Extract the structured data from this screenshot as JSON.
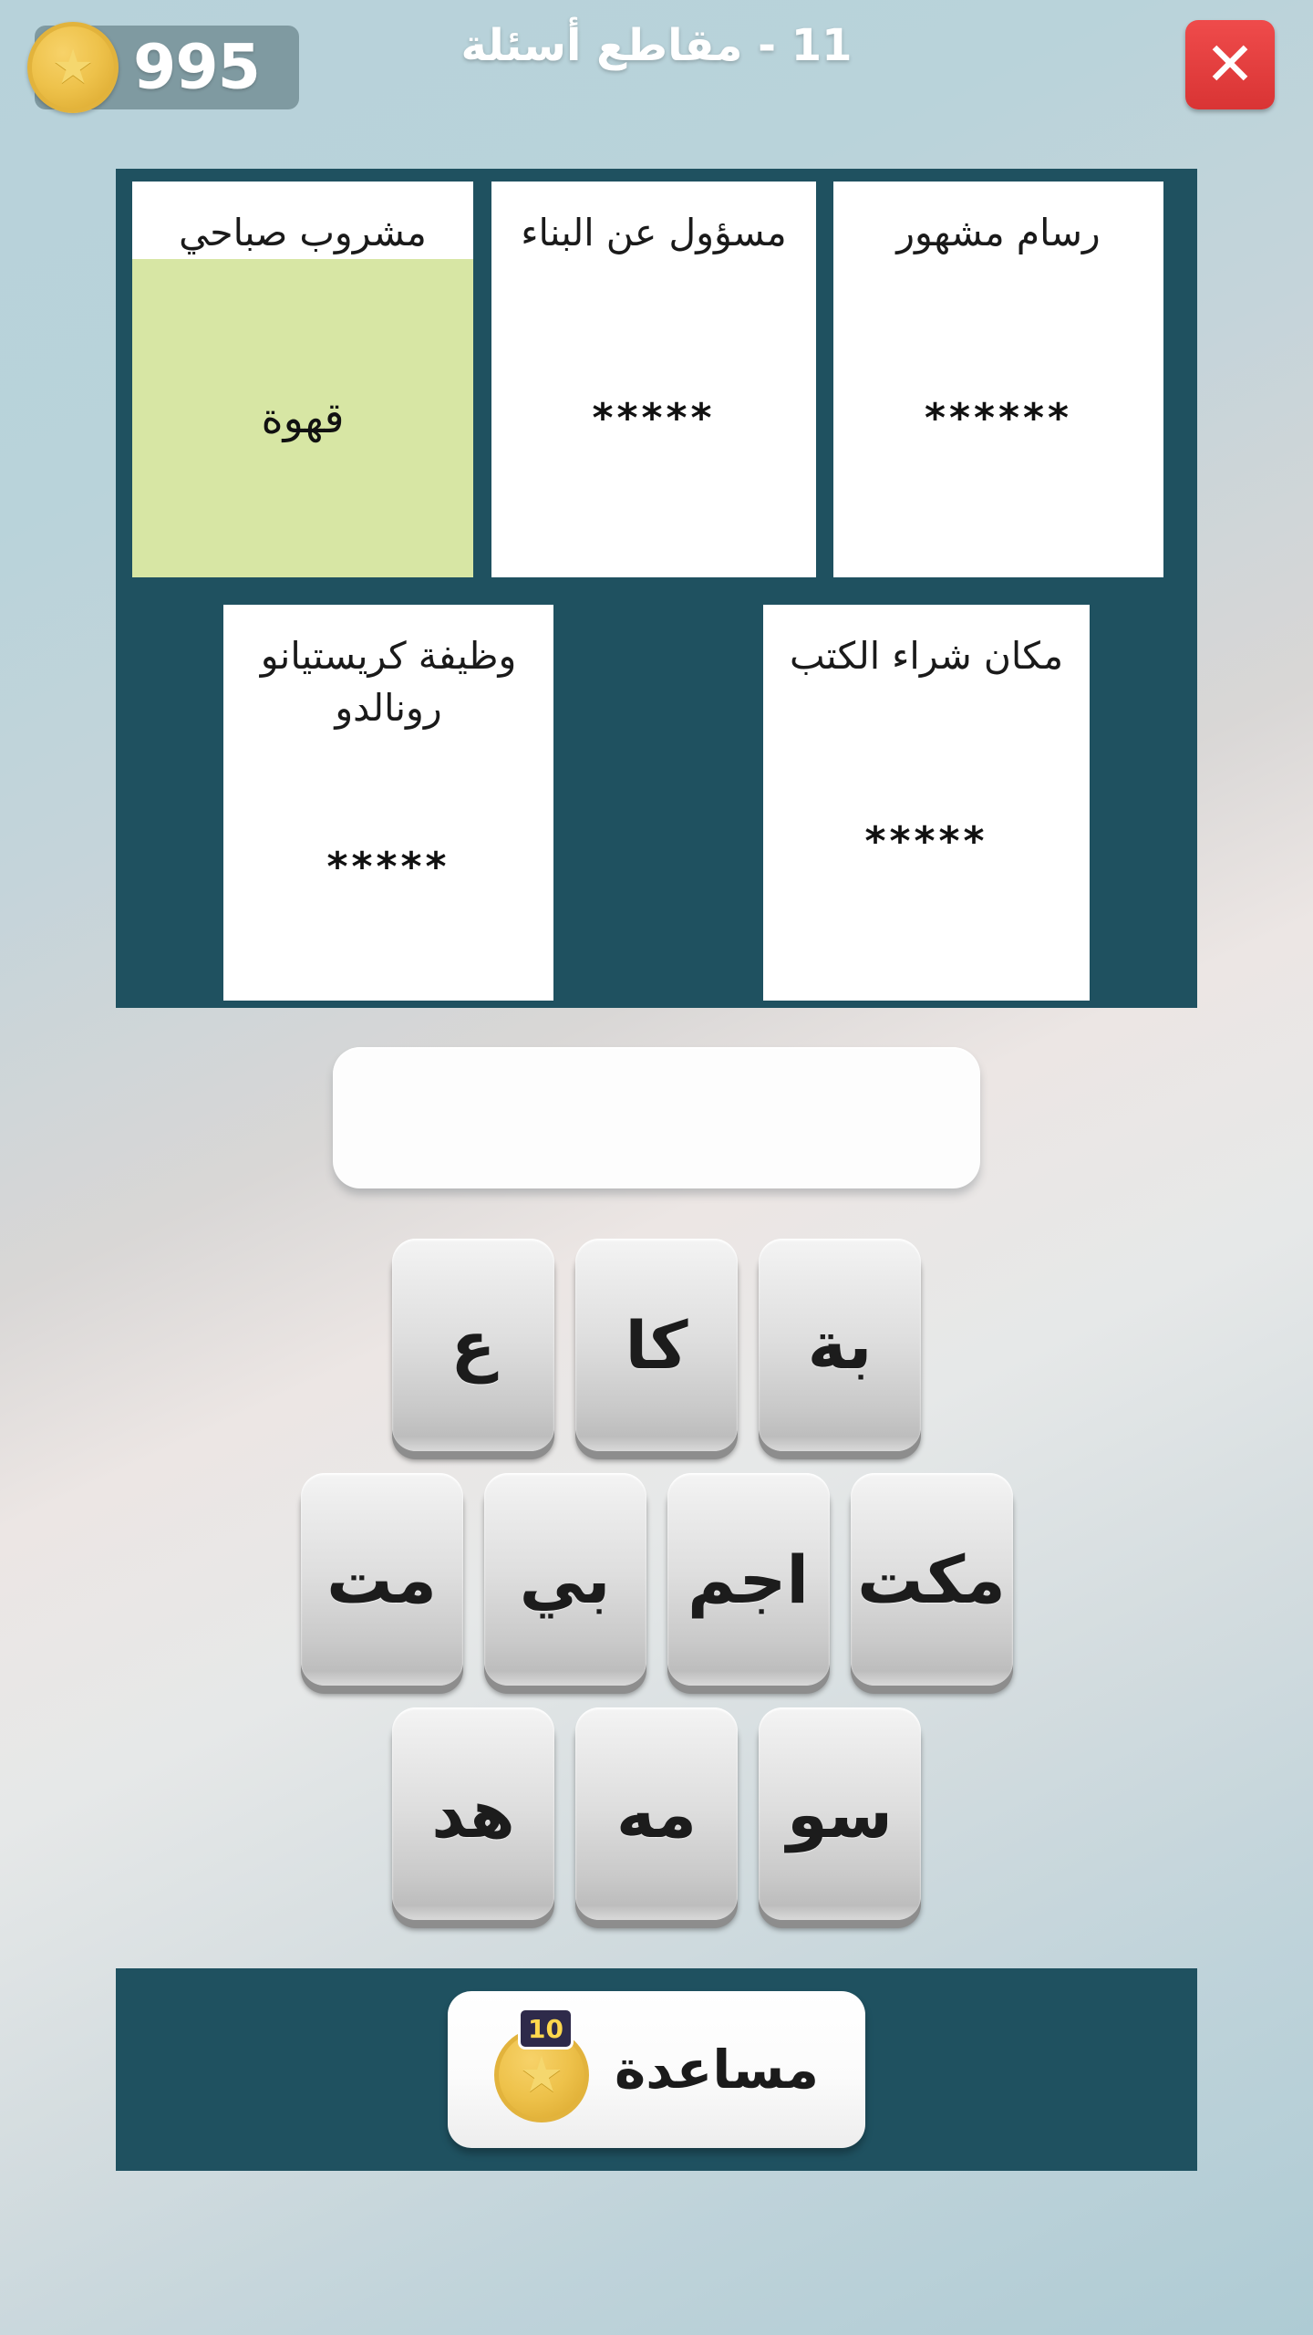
{
  "header": {
    "coin_count": "995",
    "coin_icon": "star-coin-icon",
    "level_title": "11 - مقاطع أسئلة",
    "close_icon": "✕"
  },
  "board": {
    "cards": [
      {
        "prompt": "مشروب صباحي",
        "answer": "قهوة",
        "solved": true
      },
      {
        "prompt": "مسؤول عن البناء",
        "answer": "*****",
        "solved": false
      },
      {
        "prompt": "رسام مشهور",
        "answer": "******",
        "solved": false
      },
      {
        "prompt": "وظيفة كريستيانو رونالدو",
        "answer": "*****",
        "solved": false
      },
      {
        "prompt": "مكان شراء الكتب",
        "answer": "*****",
        "solved": false
      }
    ]
  },
  "answer_slot": {
    "typed_value": "",
    "placeholder": ""
  },
  "keyboard": {
    "rows": [
      [
        "ع",
        "كا",
        "بة"
      ],
      [
        "مت",
        "بي",
        "اجم",
        "مكت"
      ],
      [
        "هد",
        "مه",
        "سو"
      ]
    ]
  },
  "help": {
    "label": "مساعدة",
    "cost": "10",
    "coin_icon": "star-coin-icon"
  },
  "colors": {
    "board_background": "#1f5160",
    "solved_answer_background": "#d7e6a4",
    "close_button": "#e03c3c",
    "coin_gold": "#eec24b",
    "page_background": "#b7d2da"
  }
}
